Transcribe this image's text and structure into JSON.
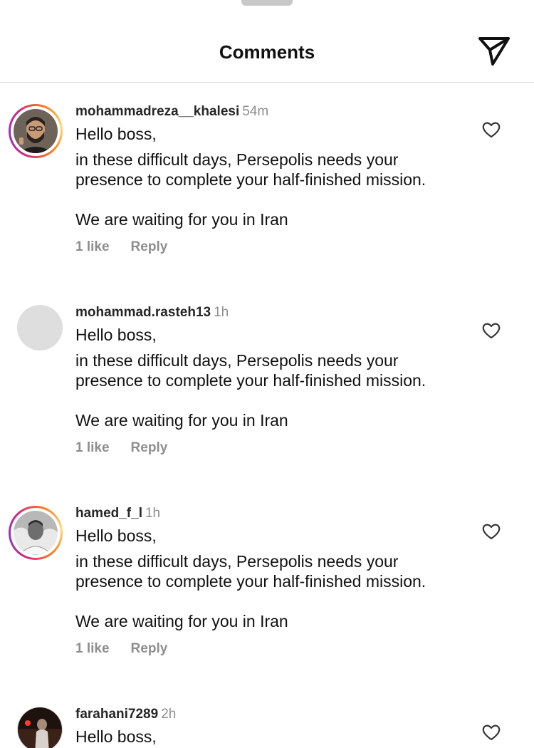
{
  "header": {
    "title": "Comments"
  },
  "comments": [
    {
      "username": "mohammadreza__khalesi",
      "time": "54m",
      "lines": [
        "Hello boss,",
        "in these difficult days, Persepolis needs your presence to complete your half-finished mission.",
        "We are waiting for you in Iran"
      ],
      "likes": "1 like",
      "reply": "Reply"
    },
    {
      "username": "mohammad.rasteh13",
      "time": "1h",
      "lines": [
        "Hello boss,",
        "in these difficult days, Persepolis needs your presence to complete your half-finished mission.",
        "We are waiting for you in Iran"
      ],
      "likes": "1 like",
      "reply": "Reply"
    },
    {
      "username": "hamed_f_l",
      "time": "1h",
      "lines": [
        "Hello boss,",
        "in these difficult days, Persepolis needs your presence to complete your half-finished mission.",
        "We are waiting for you in Iran"
      ],
      "likes": "1 like",
      "reply": "Reply"
    },
    {
      "username": "farahani7289",
      "time": "2h",
      "lines": [
        "Hello boss,"
      ]
    }
  ],
  "colors": {
    "muted": "#8e8e8e",
    "text": "#111111",
    "divider": "#dcdcdc"
  },
  "icons": {
    "share": "paper-plane-icon",
    "like": "heart-outline-icon"
  }
}
